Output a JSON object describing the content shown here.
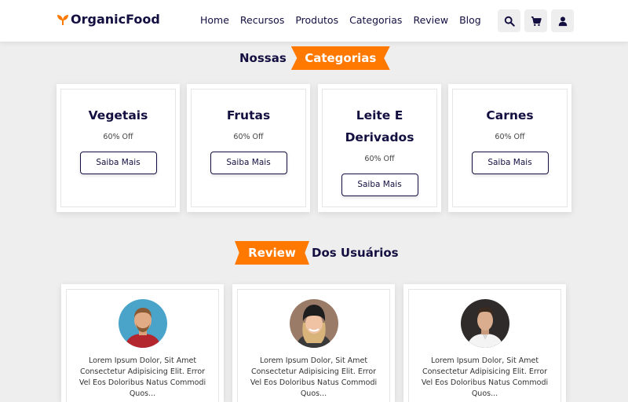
{
  "header": {
    "logo_text": "OrganicFood",
    "nav": [
      "Home",
      "Recursos",
      "Produtos",
      "Categorias",
      "Review",
      "Blog"
    ],
    "icons": [
      "search-icon",
      "cart-icon",
      "user-icon"
    ]
  },
  "categories_section": {
    "heading_plain": "Nossas",
    "heading_highlight": "Categorias",
    "cards": [
      {
        "title": "Vegetais",
        "discount": "60% Off",
        "button": "Saiba Mais"
      },
      {
        "title": "Frutas",
        "discount": "60% Off",
        "button": "Saiba Mais"
      },
      {
        "title": "Leite E Derivados",
        "discount": "60% Off",
        "button": "Saiba Mais"
      },
      {
        "title": "Carnes",
        "discount": "60% Off",
        "button": "Saiba Mais"
      }
    ]
  },
  "review_section": {
    "heading_highlight": "Review",
    "heading_plain": "Dos Usuários",
    "cards": [
      {
        "text": "Lorem Ipsum Dolor, Sit Amet Consectetur Adipisicing Elit. Error Vel Eos Doloribus Natus Commodi Quos..."
      },
      {
        "text": "Lorem Ipsum Dolor, Sit Amet Consectetur Adipisicing Elit. Error Vel Eos Doloribus Natus Commodi Quos..."
      },
      {
        "text": "Lorem Ipsum Dolor, Sit Amet Consectetur Adipisicing Elit. Error Vel Eos Doloribus Natus Commodi Quos..."
      }
    ]
  },
  "colors": {
    "accent": "#ff7800",
    "dark": "#130f40",
    "background": "#eeeeee"
  }
}
